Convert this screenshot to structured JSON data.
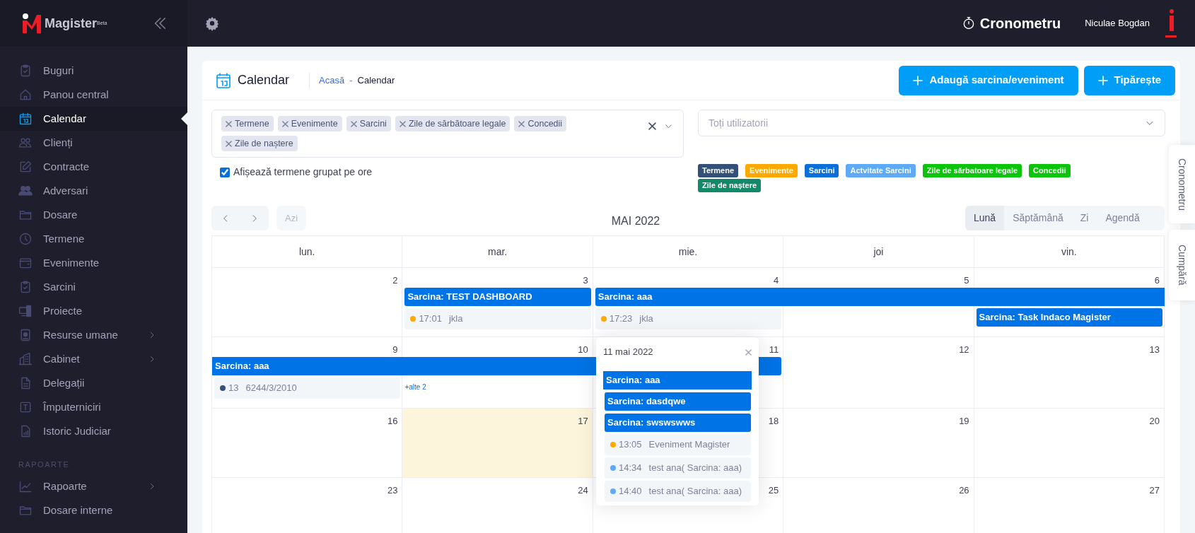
{
  "sidebar": {
    "logo": "Magister$^{Beta}$",
    "items": [
      {
        "label": "Buguri",
        "selected": false,
        "has_submenu": false
      },
      {
        "label": "Panou central",
        "selected": false,
        "has_submenu": false
      },
      {
        "label": "Calendar",
        "selected": true,
        "has_submenu": false
      },
      {
        "label": "Clienți",
        "selected": false,
        "has_submenu": false
      },
      {
        "label": "Contracte",
        "selected": false,
        "has_submenu": false
      },
      {
        "label": "Adversari",
        "selected": false,
        "has_submenu": false
      },
      {
        "label": "Dosare",
        "selected": false,
        "has_submenu": false
      },
      {
        "label": "Termene",
        "selected": false,
        "has_submenu": false
      },
      {
        "label": "Evenimente",
        "selected": false,
        "has_submenu": false
      },
      {
        "label": "Sarcini",
        "selected": false,
        "has_submenu": false
      },
      {
        "label": "Proiecte",
        "selected": false,
        "has_submenu": false
      },
      {
        "label": "Resurse umane",
        "selected": false,
        "has_submenu": true
      },
      {
        "label": "Cabinet",
        "selected": false,
        "has_submenu": true
      },
      {
        "label": "Delegații",
        "selected": false,
        "has_submenu": false
      },
      {
        "label": "Împuterniciri",
        "selected": false,
        "has_submenu": false
      },
      {
        "label": "Istoric Judiciar",
        "selected": false,
        "has_submenu": false
      }
    ],
    "section": "RAPOARTE",
    "section_items": [
      {
        "label": "Rapoarte",
        "selected": false,
        "has_submenu": true
      },
      {
        "label": "Dosare interne",
        "selected": false,
        "has_submenu": false
      }
    ]
  },
  "topbar": {
    "timer": "Cronometru",
    "user": "Niculae Bogdan"
  },
  "page_header": {
    "title": "Calendar",
    "breadcrumb": [
      "Acasă",
      "Calendar"
    ],
    "breadcrumb_separator": "-",
    "buttons": [
      "Adaugă sarcina/eveniment",
      "Tipărește"
    ]
  },
  "filters": {
    "tags": [
      "Termene",
      "Evenimente",
      "Sarcini",
      "Zile de sărbătoare legale",
      "Concedii",
      "Zile de naștere"
    ],
    "show_grouped": {
      "label": "Afișează termene grupat pe ore",
      "checked": true
    }
  },
  "users_select": {
    "placeholder": "Toți utilizatorii"
  },
  "legend": [
    {
      "label": "Termene",
      "color": "#335078"
    },
    {
      "label": "Evenimente",
      "color": "#ffa800"
    },
    {
      "label": "Sarcini",
      "color": "#0a6fd8"
    },
    {
      "label": "Actvitate Sarcini",
      "color": "#5eaaf7"
    },
    {
      "label": "Zile de sărbatoare legale",
      "color": "#0bc40b"
    },
    {
      "label": "Concedii",
      "color": "#0bc40b"
    },
    {
      "label": "Zile de naștere",
      "color": "#128a6a"
    }
  ],
  "toolbar": {
    "today_button": {
      "label": "Azi",
      "disabled": true
    },
    "month": "MAI 2022",
    "views": [
      {
        "label": "Lună",
        "selected": true
      },
      {
        "label": "Săptămână",
        "selected": false
      },
      {
        "label": "Zi",
        "selected": false
      },
      {
        "label": "Agendă",
        "selected": false
      }
    ]
  },
  "side_tabs": [
    "Cronometru",
    "Cumpără"
  ],
  "calendar": {
    "weekdays": [
      "lun.",
      "mar.",
      "mie.",
      "joi",
      "vin."
    ],
    "weeks": [
      {
        "days": [
          {
            "number": "2",
            "today": false
          },
          {
            "number": "3",
            "today": false,
            "events": [
              {
                "kind": "bar",
                "title": "Sarcina: TEST DASHBOARD",
                "continues_before": false,
                "continues_after": false
              },
              {
                "kind": "dot",
                "time": "17:01",
                "title": "jkla",
                "color": "#ffa800"
              }
            ]
          },
          {
            "number": "4",
            "today": false,
            "events": [
              {
                "kind": "bar",
                "title": "Sarcina: aaa",
                "continues_before": false,
                "continues_after": true
              },
              {
                "kind": "dot",
                "time": "17:23",
                "title": "jkla",
                "color": "#ffa800"
              }
            ]
          },
          {
            "number": "5",
            "today": false,
            "events": [
              {
                "kind": "continued"
              }
            ]
          },
          {
            "number": "6",
            "today": false,
            "events": [
              {
                "kind": "continued"
              },
              {
                "kind": "bar",
                "title": "Sarcina: Task Indaco Magister",
                "continues_before": false,
                "continues_after": false
              }
            ]
          }
        ]
      },
      {
        "days": [
          {
            "number": "9",
            "today": false,
            "events": [
              {
                "kind": "bar",
                "title": "Sarcina: aaa",
                "continues_before": true,
                "continues_after": false
              },
              {
                "kind": "dot",
                "time": "13",
                "title": "6244/3/2010",
                "color": "#335078"
              }
            ]
          },
          {
            "number": "10",
            "today": false,
            "events": [
              {
                "kind": "continued"
              },
              {
                "kind": "more",
                "label": "+alte 2"
              }
            ]
          },
          {
            "number": "11",
            "today": false,
            "events": [
              {
                "kind": "continued"
              }
            ]
          },
          {
            "number": "12",
            "today": false
          },
          {
            "number": "13",
            "today": false
          }
        ]
      },
      {
        "days": [
          {
            "number": "16",
            "today": false
          },
          {
            "number": "17",
            "today": true
          },
          {
            "number": "18",
            "today": false
          },
          {
            "number": "19",
            "today": false
          },
          {
            "number": "20",
            "today": false
          }
        ]
      },
      {
        "days": [
          {
            "number": "23",
            "today": false
          },
          {
            "number": "24",
            "today": false
          },
          {
            "number": "25",
            "today": false
          },
          {
            "number": "26",
            "today": false
          },
          {
            "number": "27",
            "today": false
          }
        ]
      }
    ],
    "popup": {
      "title": "11 mai 2022",
      "events": [
        {
          "kind": "bar",
          "title": "Sarcina: aaa",
          "continues_before": true,
          "continues_after": true
        },
        {
          "kind": "bar",
          "title": "Sarcina: dasdqwe",
          "continues_before": false,
          "continues_after": false
        },
        {
          "kind": "bar",
          "title": "Sarcina: swswswws",
          "continues_before": false,
          "continues_after": false
        },
        {
          "kind": "dot",
          "time": "13:05",
          "title": "Eveniment Magister",
          "color": "#ffa800"
        },
        {
          "kind": "dot",
          "time": "14:34",
          "title": "test ana( Sarcina: aaa)",
          "color": "#5eaaf7"
        },
        {
          "kind": "dot",
          "time": "14:40",
          "title": "test ana( Sarcina: aaa)",
          "color": "#5eaaf7"
        }
      ]
    }
  }
}
